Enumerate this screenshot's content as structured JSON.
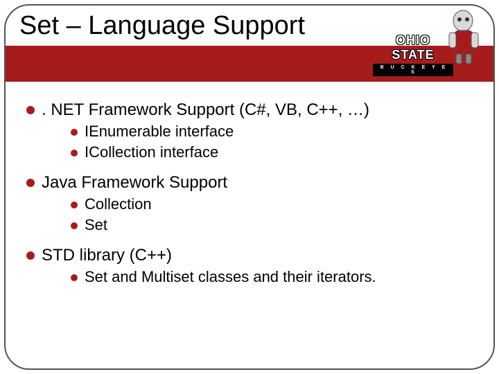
{
  "title": "Set – Language Support",
  "logo": {
    "line1": "OHIO STATE",
    "line2": "B U C K E Y E S"
  },
  "sections": [
    {
      "heading_html": ". NET Framework Support (C#, VB, C++, …)",
      "subs": [
        "IEnumerable interface",
        "ICollection interface"
      ]
    },
    {
      "heading_html": "Java Framework Support",
      "subs": [
        "Collection",
        "Set"
      ]
    },
    {
      "heading_html": "STD library (C++)",
      "subs": [
        "Set and Multiset classes and their iterators."
      ]
    }
  ]
}
